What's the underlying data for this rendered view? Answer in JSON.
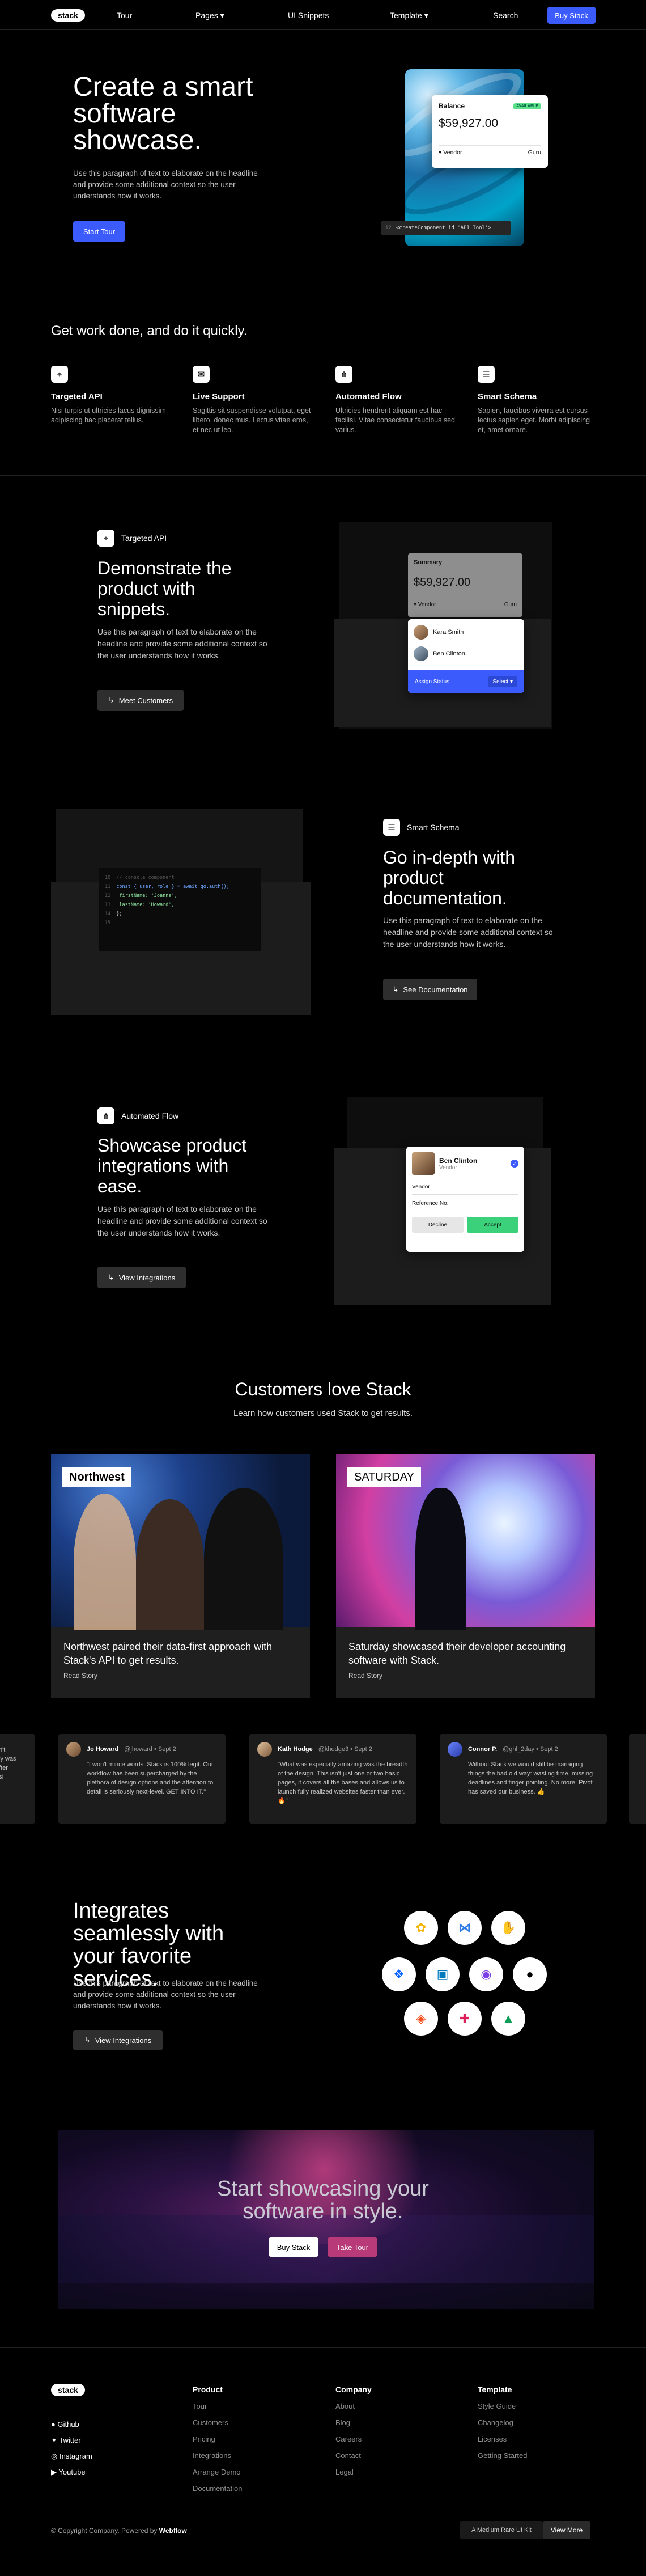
{
  "nav": {
    "logo": "stack",
    "tour": "Tour",
    "pages": "Pages",
    "ui_snippets": "UI Snippets",
    "template": "Template",
    "search": "Search",
    "cta": "Buy Stack"
  },
  "hero": {
    "title": "Create a smart software showcase.",
    "desc": "Use this paragraph of text to elaborate on the headline and provide some additional context so the user understands how it works.",
    "cta": "Start Tour",
    "card": {
      "label": "Balance",
      "badge": "AVAILABLE",
      "amount": "$59,927.00",
      "vendor": "Vendor",
      "vendor_name": "Guru"
    },
    "code": "<createComponent id 'API Tool'>"
  },
  "features": {
    "title": "Get work done, and do it quickly.",
    "items": [
      {
        "icon": "api-icon",
        "title": "Targeted API",
        "desc": "Nisi turpis ut ultricies lacus dignissim adipiscing hac placerat tellus."
      },
      {
        "icon": "chat-icon",
        "title": "Live Support",
        "desc": "Sagittis sit suspendisse volutpat, eget libero, donec mus. Lectus vitae eros, et nec ut leo."
      },
      {
        "icon": "flow-icon",
        "title": "Automated Flow",
        "desc": "Ultricies hendrerit aliquam est hac facilisi. Vitae consectetur faucibus sed varius."
      },
      {
        "icon": "schema-icon",
        "title": "Smart Schema",
        "desc": "Sapien, faucibus viverra est cursus lectus sapien eget. Morbi adipiscing et, amet ornare."
      }
    ]
  },
  "section1": {
    "tag": "Targeted API",
    "title": "Demonstrate the product with snippets.",
    "desc": "Use this paragraph of text to elaborate on the headline and provide some additional context so the user understands how it works.",
    "cta": "Meet Customers",
    "summary": "Summary",
    "amount": "$59,927.00",
    "vendor": "Vendor",
    "vendor_name": "Guru",
    "people": [
      "Kara Smith",
      "Ben Clinton"
    ],
    "assign": "Assign Status",
    "select": "Select"
  },
  "section2": {
    "tag": "Smart Schema",
    "title": "Go in-depth with product documentation.",
    "desc": "Use this paragraph of text to elaborate on the headline and provide some additional context so the user understands how it works.",
    "cta": "See Documentation",
    "code_lines": [
      {
        "n": "10",
        "t": "// console component"
      },
      {
        "n": "11",
        "t": "const { user, role } = await go.auth();"
      },
      {
        "n": "12",
        "t": "  firstName: 'Joanna',"
      },
      {
        "n": "13",
        "t": "  lastName: 'Howard',"
      },
      {
        "n": "14",
        "t": "};"
      },
      {
        "n": "15",
        "t": ""
      }
    ]
  },
  "section3": {
    "tag": "Automated Flow",
    "title": "Showcase product integrations with ease.",
    "desc": "Use this paragraph of text to elaborate on the headline and provide some additional context so the user understands how it works.",
    "cta": "View Integrations",
    "person": "Ben Clinton",
    "role": "Vendor",
    "vendor": "Vendor",
    "ref": "Reference No.",
    "decline": "Decline",
    "accept": "Accept"
  },
  "customers": {
    "title": "Customers love Stack",
    "subtitle": "Learn how customers used Stack to get results.",
    "cards": [
      {
        "brand": "Northwest",
        "title": "Northwest paired their data-first approach with Stack's API to get results.",
        "link": "Read Story"
      },
      {
        "brand": "SATURDAY",
        "title": "Saturday showcased their developer accounting software with Stack.",
        "link": "Read Story"
      }
    ]
  },
  "testimonials": [
    {
      "name": "",
      "handle": "",
      "text": "n't\nly was\nfter\ns!"
    },
    {
      "name": "Jo Howard",
      "handle": "@jhoward • Sept 2",
      "text": "\"I won't mince words. Stack is 100% legit. Our workflow has been supercharged by the plethora of design options and the attention to detail is seriously next-level. GET INTO IT.\""
    },
    {
      "name": "Kath Hodge",
      "handle": "@khodge3 • Sept 2",
      "text": "\"What was especially amazing was the breadth of the design. This isn't just one or two basic pages, it covers all the bases and allows us to launch fully realized websites faster than ever. 🔥\""
    },
    {
      "name": "Connor P.",
      "handle": "@ghl_2day • Sept 2",
      "text": "Without Stack we would still be managing things the bad old way: wasting time, missing deadlines and finger pointing. No more! Pivot has saved our business. 👍"
    },
    {
      "name": "",
      "handle": "",
      "text": ""
    }
  ],
  "integrations": {
    "title": "Integrates seamlessly with your favorite services.",
    "desc": "Use this paragraph of text to elaborate on the headline and provide some additional context so the user understands how it works.",
    "cta": "View Integrations",
    "icons": [
      "google-photos-icon",
      "visual-studio-icon",
      "hand-icon",
      "dropbox-icon",
      "trello-icon",
      "pixelmator-icon",
      "github-icon",
      "figma-icon",
      "slack-icon",
      "google-drive-icon"
    ]
  },
  "cta": {
    "title": "Start showcasing your software in style.",
    "buy": "Buy Stack",
    "tour": "Take Tour"
  },
  "footer": {
    "logo": "stack",
    "social": [
      "Github",
      "Twitter",
      "Instagram",
      "Youtube"
    ],
    "product": {
      "title": "Product",
      "links": [
        "Tour",
        "Customers",
        "Pricing",
        "Integrations",
        "Arrange Demo",
        "Documentation"
      ]
    },
    "company": {
      "title": "Company",
      "links": [
        "About",
        "Blog",
        "Careers",
        "Contact",
        "Legal"
      ]
    },
    "template": {
      "title": "Template",
      "links": [
        "Style Guide",
        "Changelog",
        "Licenses",
        "Getting Started"
      ]
    },
    "copyright": "© Copyright Company. Powered by",
    "powered": "Webflow",
    "badge": "A Medium Rare UI Kit",
    "more": "View More"
  }
}
